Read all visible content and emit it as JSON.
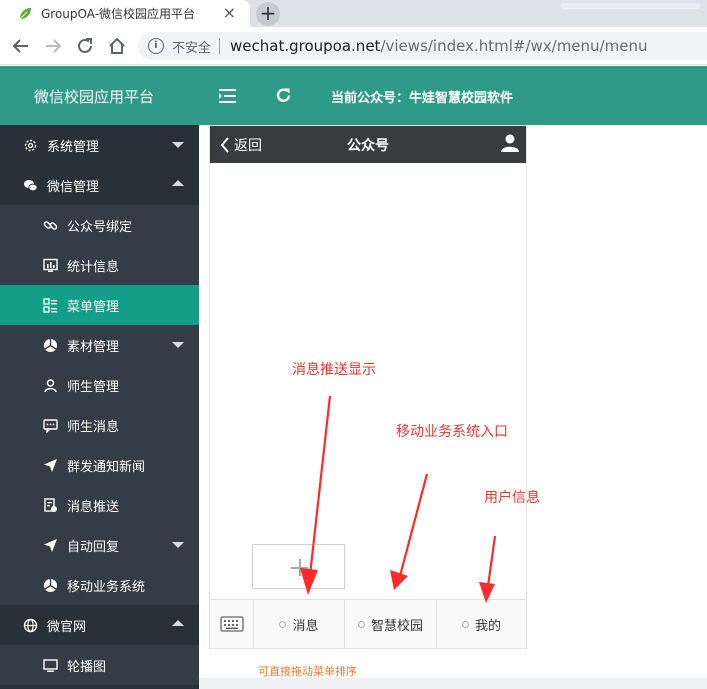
{
  "browser": {
    "tab_title": "GroupOA-微信校园应用平台",
    "tab_close": "×",
    "new_tab": "+",
    "security_label": "不安全",
    "url_host": "wechat.groupoa.net",
    "url_path": "/views/index.html#/wx/menu/menu"
  },
  "header": {
    "app_title": "微信校园应用平台",
    "current_account": "当前公众号：牛娃智慧校园软件",
    "color": "#2f9a87"
  },
  "sidebar": {
    "items": [
      {
        "label": "系统管理",
        "icon": "gear-icon",
        "level": "parent",
        "caret": "down"
      },
      {
        "label": "微信管理",
        "icon": "wechat-icon",
        "level": "parent",
        "caret": "up"
      },
      {
        "label": "公众号绑定",
        "icon": "link-icon",
        "level": "child"
      },
      {
        "label": "统计信息",
        "icon": "chart-icon",
        "level": "child"
      },
      {
        "label": "菜单管理",
        "icon": "menu-list-icon",
        "level": "child",
        "active": true
      },
      {
        "label": "素材管理",
        "icon": "materials-icon",
        "level": "child",
        "caret": "down"
      },
      {
        "label": "师生管理",
        "icon": "user-icon",
        "level": "child"
      },
      {
        "label": "师生消息",
        "icon": "message-icon",
        "level": "child"
      },
      {
        "label": "群发通知新闻",
        "icon": "send-icon",
        "level": "child"
      },
      {
        "label": "消息推送",
        "icon": "push-doc-icon",
        "level": "child"
      },
      {
        "label": "自动回复",
        "icon": "send-icon",
        "level": "child",
        "caret": "down"
      },
      {
        "label": "移动业务系统",
        "icon": "materials-icon",
        "level": "child"
      },
      {
        "label": "微官网",
        "icon": "globe-icon",
        "level": "parent",
        "caret": "up"
      },
      {
        "label": "轮播图",
        "icon": "monitor-icon",
        "level": "child"
      }
    ],
    "active_color": "#139e8a"
  },
  "phone": {
    "back_label": "返回",
    "title": "公众号",
    "menu_items": [
      "消息",
      "智慧校园",
      "我的"
    ],
    "hint": "可直接拖动菜单排序"
  },
  "annotations": {
    "push_display": "消息推送显示",
    "mobile_entry": "移动业务系统入口",
    "user_info": "用户信息",
    "color": "#ef3333"
  }
}
